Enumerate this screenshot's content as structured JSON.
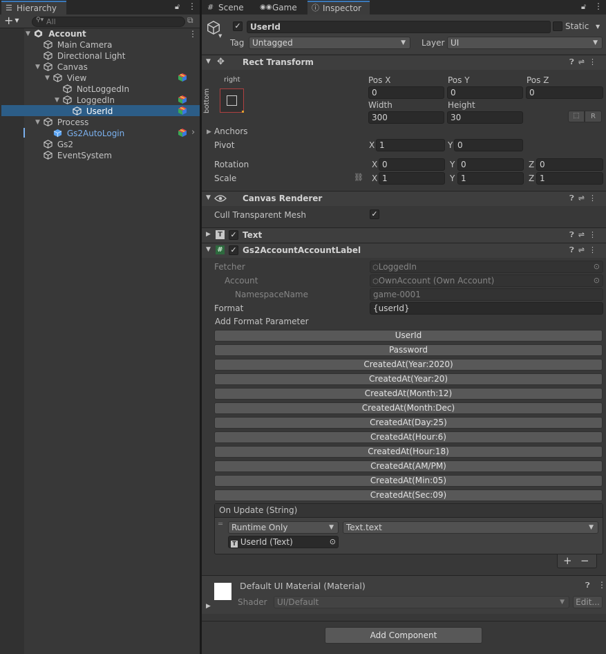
{
  "hierarchy": {
    "tab_label": "Hierarchy",
    "search_placeholder": "All",
    "add_label": "+",
    "items": [
      {
        "name": "Account"
      },
      {
        "name": "Main Camera"
      },
      {
        "name": "Directional Light"
      },
      {
        "name": "Canvas"
      },
      {
        "name": "View"
      },
      {
        "name": "NotLoggedIn"
      },
      {
        "name": "LoggedIn"
      },
      {
        "name": "UserId"
      },
      {
        "name": "Process"
      },
      {
        "name": "Gs2AutoLogin"
      },
      {
        "name": "Gs2"
      },
      {
        "name": "EventSystem"
      }
    ]
  },
  "tabs": {
    "scene": "Scene",
    "game": "Game",
    "inspector": "Inspector"
  },
  "object": {
    "name": "UserId",
    "active": true,
    "static_label": "Static",
    "tag_label": "Tag",
    "tag_value": "Untagged",
    "layer_label": "Layer",
    "layer_value": "UI"
  },
  "rect_transform": {
    "title": "Rect Transform",
    "anchor_h": "right",
    "anchor_v": "bottom",
    "pos_x_label": "Pos X",
    "pos_y_label": "Pos Y",
    "pos_z_label": "Pos Z",
    "pos_x": "0",
    "pos_y": "0",
    "pos_z": "0",
    "width_label": "Width",
    "height_label": "Height",
    "width": "300",
    "height": "30",
    "r_button": "R",
    "anchors_label": "Anchors",
    "pivot_label": "Pivot",
    "pivot_x": "1",
    "pivot_y": "0",
    "rotation_label": "Rotation",
    "rot_x": "0",
    "rot_y": "0",
    "rot_z": "0",
    "scale_label": "Scale",
    "scale_x": "1",
    "scale_y": "1",
    "scale_z": "1",
    "x": "X",
    "y": "Y",
    "z": "Z"
  },
  "canvas_renderer": {
    "title": "Canvas Renderer",
    "cull_label": "Cull Transparent Mesh",
    "cull_checked": true
  },
  "text_component": {
    "title": "Text",
    "icon": "T"
  },
  "label_component": {
    "title": "Gs2AccountAccountLabel",
    "icon": "#",
    "fetcher_label": "Fetcher",
    "fetcher_value": "LoggedIn",
    "account_label": "Account",
    "account_value": "OwnAccount (Own Account)",
    "namespace_label": "NamespaceName",
    "namespace_value": "game-0001",
    "format_label": "Format",
    "format_value": "{userId}",
    "add_param_label": "Add Format Parameter",
    "params": [
      "UserId",
      "Password",
      "CreatedAt(Year:2020)",
      "CreatedAt(Year:20)",
      "CreatedAt(Month:12)",
      "CreatedAt(Month:Dec)",
      "CreatedAt(Day:25)",
      "CreatedAt(Hour:6)",
      "CreatedAt(Hour:18)",
      "CreatedAt(AM/PM)",
      "CreatedAt(Min:05)",
      "CreatedAt(Sec:09)"
    ],
    "event_title": "On Update (String)",
    "runtime_value": "Runtime Only",
    "function_value": "Text.text",
    "target_value": "UserId (Text)",
    "plus": "+",
    "minus": "−"
  },
  "material": {
    "title": "Default UI Material (Material)",
    "shader_label": "Shader",
    "shader_value": "UI/Default",
    "edit_label": "Edit..."
  },
  "add_component_label": "Add Component",
  "colors": {
    "selection": "#2c5d87",
    "accent": "#3a79bb",
    "prefab_blue": "#7bb1ef"
  },
  "icons": [
    "hamburger-icon",
    "lock-icon",
    "kebab-icon",
    "search-icon",
    "cube-icon",
    "unity-icon",
    "prefab-icon",
    "gear-icon",
    "help-icon",
    "settings-sliders-icon",
    "eye-icon",
    "gamepad-icon",
    "info-icon",
    "link-icon",
    "target-icon"
  ]
}
